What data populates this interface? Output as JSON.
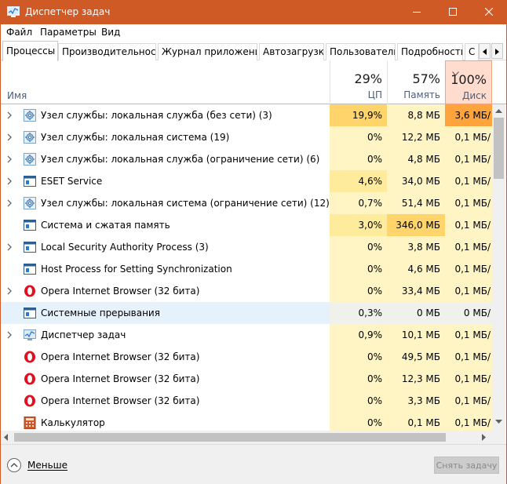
{
  "window": {
    "title": "Диспетчер задач"
  },
  "menu": {
    "file": "Файл",
    "options": "Параметры",
    "view": "Вид"
  },
  "tabs": [
    "Процессы",
    "Производительность",
    "Журнал приложений",
    "Автозагрузка",
    "Пользователи",
    "Подробности",
    "С"
  ],
  "columns": {
    "name": "Имя",
    "cpu": {
      "percent": "29%",
      "label": "ЦП"
    },
    "memory": {
      "percent": "57%",
      "label": "Память"
    },
    "disk": {
      "percent": "100%",
      "label": "Диск"
    }
  },
  "rows": [
    {
      "name": "Узел службы: локальная служба (без сети) (3)",
      "cpu": "19,9%",
      "mem": "8,8 МБ",
      "disk": "3,6 МБ/",
      "icon": "gear-icon",
      "expandable": true
    },
    {
      "name": "Узел службы: локальная система (19)",
      "cpu": "0%",
      "mem": "12,2 МБ",
      "disk": "0,1 МБ/",
      "icon": "gear-icon",
      "expandable": true
    },
    {
      "name": "Узел службы: локальная служба (ограничение сети) (6)",
      "cpu": "0%",
      "mem": "4,8 МБ",
      "disk": "0,1 МБ/",
      "icon": "gear-icon",
      "expandable": true
    },
    {
      "name": "ESET Service",
      "cpu": "4,6%",
      "mem": "34,0 МБ",
      "disk": "0,1 МБ/",
      "icon": "window-icon",
      "expandable": true
    },
    {
      "name": "Узел службы: локальная система (ограничение сети) (12)",
      "cpu": "0,7%",
      "mem": "51,4 МБ",
      "disk": "0,1 МБ/",
      "icon": "gear-icon",
      "expandable": true
    },
    {
      "name": "Система и сжатая память",
      "cpu": "3,0%",
      "mem": "346,0 МБ",
      "disk": "0,1 МБ/",
      "icon": "window-icon",
      "expandable": false
    },
    {
      "name": "Local Security Authority Process (3)",
      "cpu": "0%",
      "mem": "3,8 МБ",
      "disk": "0,1 МБ/",
      "icon": "window-icon",
      "expandable": true
    },
    {
      "name": "Host Process for Setting Synchronization",
      "cpu": "0%",
      "mem": "4,6 МБ",
      "disk": "0,1 МБ/",
      "icon": "window-icon",
      "expandable": false
    },
    {
      "name": "Opera Internet Browser (32 бита)",
      "cpu": "0%",
      "mem": "33,4 МБ",
      "disk": "0,1 МБ/",
      "icon": "opera-icon",
      "expandable": true
    },
    {
      "name": "Системные прерывания",
      "cpu": "0,3%",
      "mem": "0 МБ",
      "disk": "0 МБ/",
      "icon": "window-icon",
      "expandable": false
    },
    {
      "name": "Диспетчер задач",
      "cpu": "0,9%",
      "mem": "10,1 МБ",
      "disk": "0,1 МБ/",
      "icon": "taskmgr-icon",
      "expandable": true
    },
    {
      "name": "Opera Internet Browser (32 бита)",
      "cpu": "0%",
      "mem": "49,5 МБ",
      "disk": "0,1 МБ/",
      "icon": "opera-icon",
      "expandable": false
    },
    {
      "name": "Opera Internet Browser (32 бита)",
      "cpu": "0%",
      "mem": "12,3 МБ",
      "disk": "0,1 МБ/",
      "icon": "opera-icon",
      "expandable": false
    },
    {
      "name": "Opera Internet Browser (32 бита)",
      "cpu": "0%",
      "mem": "3,3 МБ",
      "disk": "0,1 МБ/",
      "icon": "opera-icon",
      "expandable": false
    },
    {
      "name": "Калькулятор",
      "cpu": "0%",
      "mem": "0,1 МБ",
      "disk": "0,1 МБ/",
      "icon": "calculator-icon",
      "expandable": false
    }
  ],
  "footer": {
    "less": "Меньше",
    "end_task": "Снять задачу"
  },
  "colors": {
    "titlebar": "#cf5a26",
    "cell_light": "#fff4c4",
    "cell_medium": "#ffeb9c",
    "cell_high": "#ffd46b",
    "cell_disk_high": "#ffa43d",
    "selected_row": "#e5f1fb"
  }
}
